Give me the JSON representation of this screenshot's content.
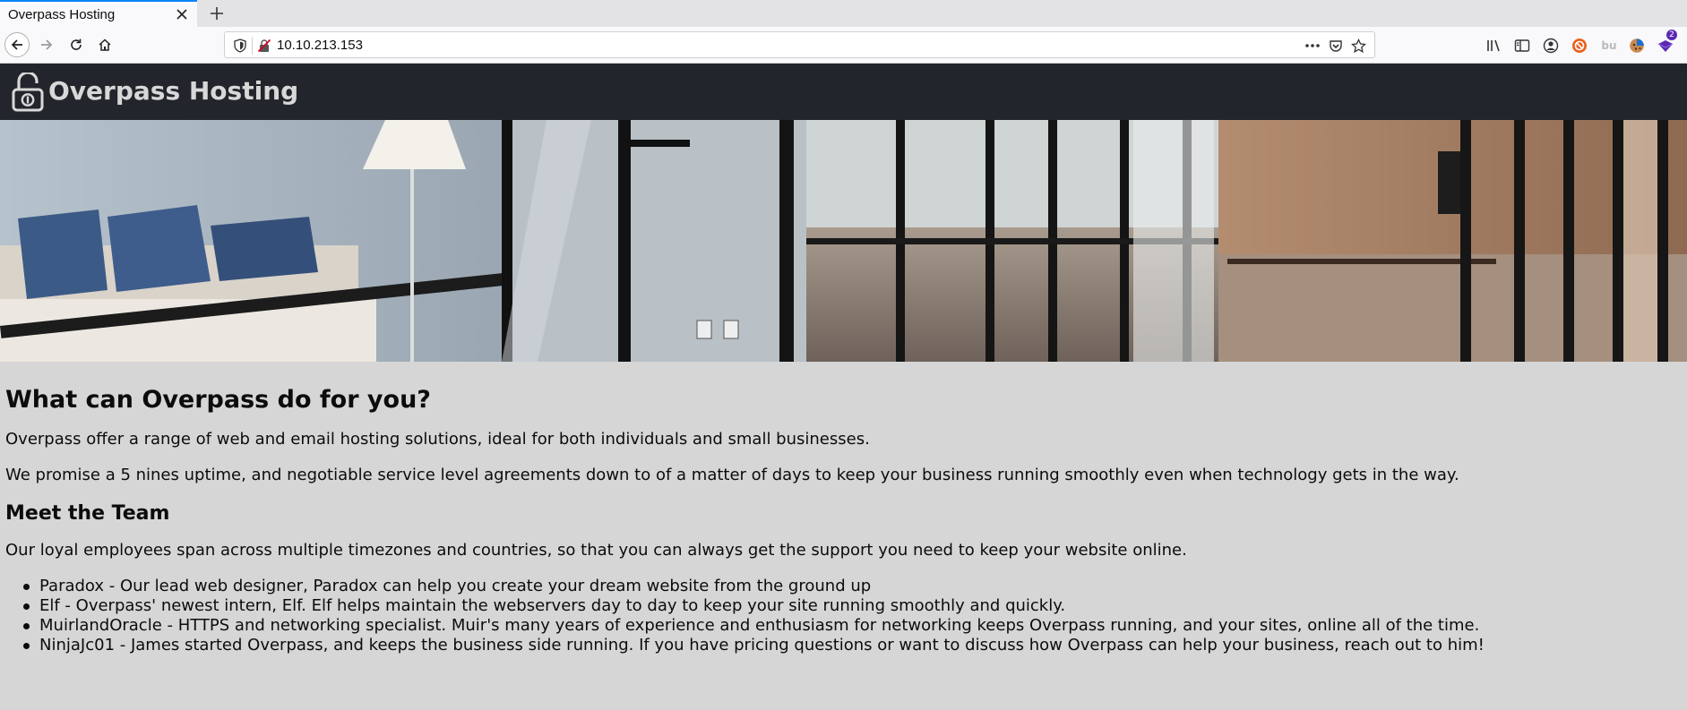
{
  "browser": {
    "tab_title": "Overpass Hosting",
    "url": "10.10.213.153",
    "extension_badge": "2",
    "ext_label": "bu"
  },
  "site": {
    "title": "Overpass Hosting"
  },
  "main": {
    "heading": "What can Overpass do for you?",
    "intro_1": "Overpass offer a range of web and email hosting solutions, ideal for both individuals and small businesses.",
    "intro_2": "We promise a 5 nines uptime, and negotiable service level agreements down to of a matter of days to keep your business running smoothly even when technology gets in the way.",
    "team_heading": "Meet the Team",
    "team_intro": "Our loyal employees span across multiple timezones and countries, so that you can always get the support you need to keep your website online.",
    "team": [
      "Paradox - Our lead web designer, Paradox can help you create your dream website from the ground up",
      "Elf - Overpass' newest intern, Elf. Elf helps maintain the webservers day to day to keep your site running smoothly and quickly.",
      "MuirlandOracle - HTTPS and networking specialist. Muir's many years of experience and enthusiasm for networking keeps Overpass running, and your sites, online all of the time.",
      "NinjaJc01 - James started Overpass, and keeps the business side running. If you have pricing questions or want to discuss how Overpass can help your business, reach out to him!"
    ]
  },
  "colors": {
    "header_bg": "#22252b",
    "page_bg": "#d6d6d6",
    "tab_accent": "#0a84ff"
  }
}
